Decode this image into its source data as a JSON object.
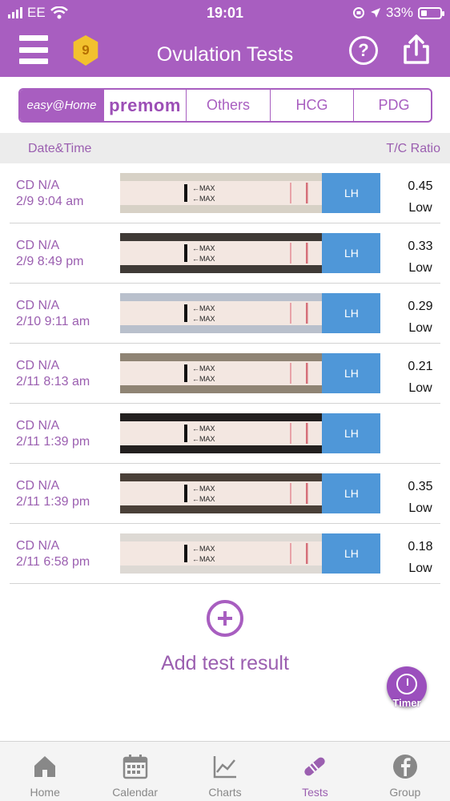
{
  "status": {
    "carrier": "EE",
    "time": "19:01",
    "battery": "33%",
    "battery_level": 0.33
  },
  "header": {
    "title": "Ovulation Tests",
    "badge_count": "9"
  },
  "brand_tabs": [
    {
      "label": "easy@Home",
      "active": true
    },
    {
      "label": "premom",
      "active": false
    },
    {
      "label": "Others",
      "active": false
    },
    {
      "label": "HCG",
      "active": false
    },
    {
      "label": "PDG",
      "active": false
    }
  ],
  "columns": {
    "left": "Date&Time",
    "right": "T/C Ratio"
  },
  "tests": [
    {
      "cd": "CD N/A",
      "datetime": "2/9 9:04 am",
      "ratio": "0.45",
      "level": "Low",
      "strip_labels": [
        "MAX",
        "MAX"
      ],
      "strip_brand": "LH"
    },
    {
      "cd": "CD N/A",
      "datetime": "2/9 8:49 pm",
      "ratio": "0.33",
      "level": "Low",
      "strip_labels": [
        "MAX",
        "MAX"
      ],
      "strip_brand": "LH"
    },
    {
      "cd": "CD N/A",
      "datetime": "2/10 9:11 am",
      "ratio": "0.29",
      "level": "Low",
      "strip_labels": [
        "MAX",
        "MAX"
      ],
      "strip_brand": "LH"
    },
    {
      "cd": "CD N/A",
      "datetime": "2/11 8:13 am",
      "ratio": "0.21",
      "level": "Low",
      "strip_labels": [
        "MAX",
        "MAX"
      ],
      "strip_brand": "LH"
    },
    {
      "cd": "CD N/A",
      "datetime": "2/11 1:39 pm",
      "ratio": "",
      "level": "",
      "strip_labels": [
        "MAX",
        "MAX"
      ],
      "strip_brand": "LH"
    },
    {
      "cd": "CD N/A",
      "datetime": "2/11 1:39 pm",
      "ratio": "0.35",
      "level": "Low",
      "strip_labels": [
        "MAX",
        "MAX"
      ],
      "strip_brand": "LH"
    },
    {
      "cd": "CD N/A",
      "datetime": "2/11 6:58 pm",
      "ratio": "0.18",
      "level": "Low",
      "strip_labels": [
        "MAX",
        "MAX"
      ],
      "strip_brand": "LH"
    }
  ],
  "add_test": {
    "label": "Add test result"
  },
  "timer": {
    "label": "Timer"
  },
  "bottom_nav": [
    {
      "label": "Home",
      "icon": "home-icon",
      "active": false
    },
    {
      "label": "Calendar",
      "icon": "calendar-icon",
      "active": false
    },
    {
      "label": "Charts",
      "icon": "chart-icon",
      "active": false
    },
    {
      "label": "Tests",
      "icon": "test-strip-icon",
      "active": true
    },
    {
      "label": "Group",
      "icon": "facebook-icon",
      "active": false
    }
  ],
  "colors": {
    "accent": "#a85ec0",
    "text_accent": "#9b5fb0",
    "active_nav": "#9b5fb0",
    "inactive_nav": "#888888"
  }
}
